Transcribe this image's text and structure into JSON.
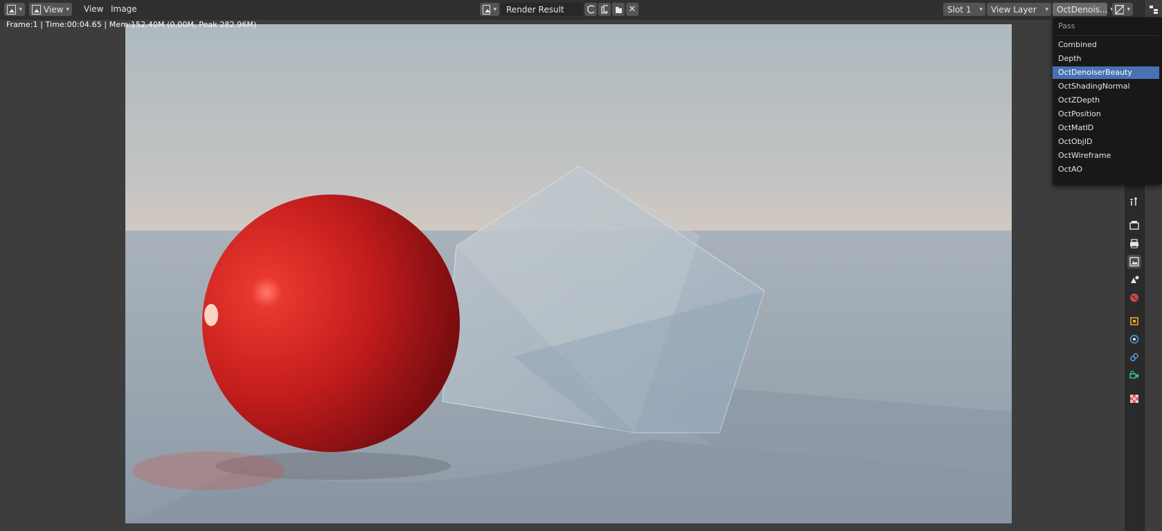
{
  "header": {
    "menus": [
      "View",
      "View",
      "Image"
    ],
    "image_name": "Render Result",
    "slot": "Slot 1",
    "view_layer": "View Layer",
    "pass_selected": "OctDenois..."
  },
  "status": "Frame:1 | Time:00:04.65 | Mem:152.40M (0.00M, Peak 282.96M)",
  "dropdown": {
    "title": "Pass",
    "items": [
      "Combined",
      "Depth",
      "OctDenoiserBeauty",
      "OctShadingNormal",
      "OctZDepth",
      "OctPosition",
      "OctMatID",
      "OctObjID",
      "OctWireframe",
      "OctAO"
    ],
    "selected_index": 2
  },
  "colors": {
    "accent": "#4772b3",
    "header": "#303030",
    "viewport": "#3d3d3d",
    "sphere": "#c81e1e"
  },
  "sidebar_tabs": [
    "tool-icon",
    "render-icon",
    "output-icon",
    "view-layer-icon",
    "scene-icon",
    "world-icon",
    "object-icon",
    "modifier-icon",
    "physics-icon",
    "constraints-icon",
    "texture-icon"
  ]
}
